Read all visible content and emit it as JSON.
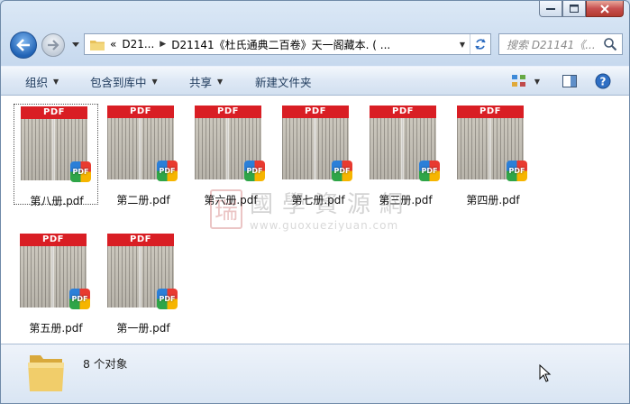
{
  "window": {
    "caption_buttons": [
      "minimize",
      "maximize",
      "close"
    ]
  },
  "nav": {
    "address": {
      "prefix": "«",
      "segment1": "D21...",
      "segment2": "D21141《杜氏通典二百卷》天一阁藏本. ( ..."
    },
    "search_placeholder": "搜索 D21141《...",
    "icons": [
      "back-icon",
      "forward-icon",
      "history-dropdown-icon",
      "folder-icon",
      "refresh-icon",
      "search-icon"
    ]
  },
  "toolbar": {
    "organize": "组织",
    "include_library": "包含到库中",
    "share": "共享",
    "new_folder": "新建文件夹",
    "icons": [
      "view-options-icon",
      "preview-pane-icon",
      "help-icon"
    ]
  },
  "files": [
    {
      "name": "第八册.pdf",
      "selected": true
    },
    {
      "name": "第二册.pdf",
      "selected": false
    },
    {
      "name": "第六册.pdf",
      "selected": false
    },
    {
      "name": "第七册.pdf",
      "selected": false
    },
    {
      "name": "第三册.pdf",
      "selected": false
    },
    {
      "name": "第四册.pdf",
      "selected": false
    },
    {
      "name": "第五册.pdf",
      "selected": false
    },
    {
      "name": "第一册.pdf",
      "selected": false
    }
  ],
  "thumbnail": {
    "header_text": "PDF",
    "badge_text": "PDF"
  },
  "watermark": {
    "seal": "瑞",
    "title": "國學資源網",
    "url": "www.guoxueziyuan.com"
  },
  "details": {
    "item_count": "8 个对象"
  },
  "colors": {
    "pdf_red": "#d91e24",
    "window_frame": "#c7d9ee",
    "close_button": "#c75050"
  }
}
